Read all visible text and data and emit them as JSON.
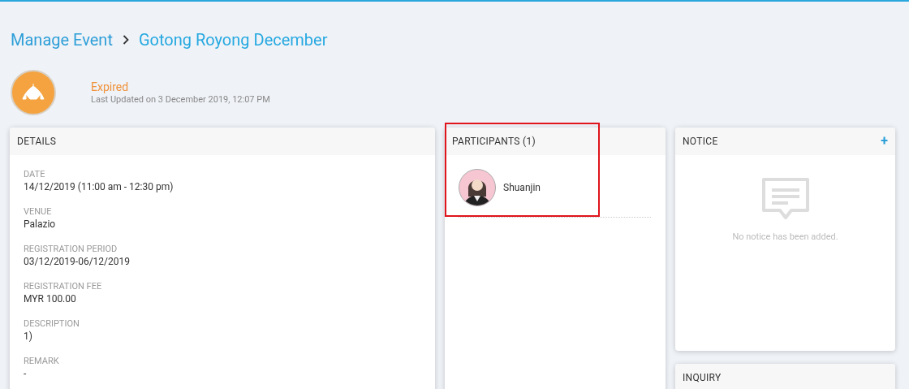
{
  "breadcrumb": [
    "Manage Event",
    "Gotong Royong December"
  ],
  "event": {
    "status": "Expired",
    "updated": "Last Updated on 3 December 2019, 12:07 PM"
  },
  "details": {
    "title": "DETAILS",
    "fields": [
      {
        "label": "DATE",
        "value": "14/12/2019 (11:00 am - 12:30 pm)"
      },
      {
        "label": "VENUE",
        "value": "Palazio"
      },
      {
        "label": "REGISTRATION PERIOD",
        "value": "03/12/2019-06/12/2019"
      },
      {
        "label": "REGISTRATION FEE",
        "value": "MYR 100.00"
      },
      {
        "label": "DESCRIPTION",
        "value": "1)"
      },
      {
        "label": "REMARK",
        "value": "-"
      }
    ]
  },
  "participants": {
    "title": "PARTICIPANTS (1)",
    "highlighted": true,
    "items": [
      {
        "name": "Shuanjin"
      }
    ]
  },
  "notice": {
    "title": "NOTICE",
    "add": "+",
    "empty": "No notice has been added."
  },
  "inquiry": {
    "title": "INQUIRY"
  }
}
